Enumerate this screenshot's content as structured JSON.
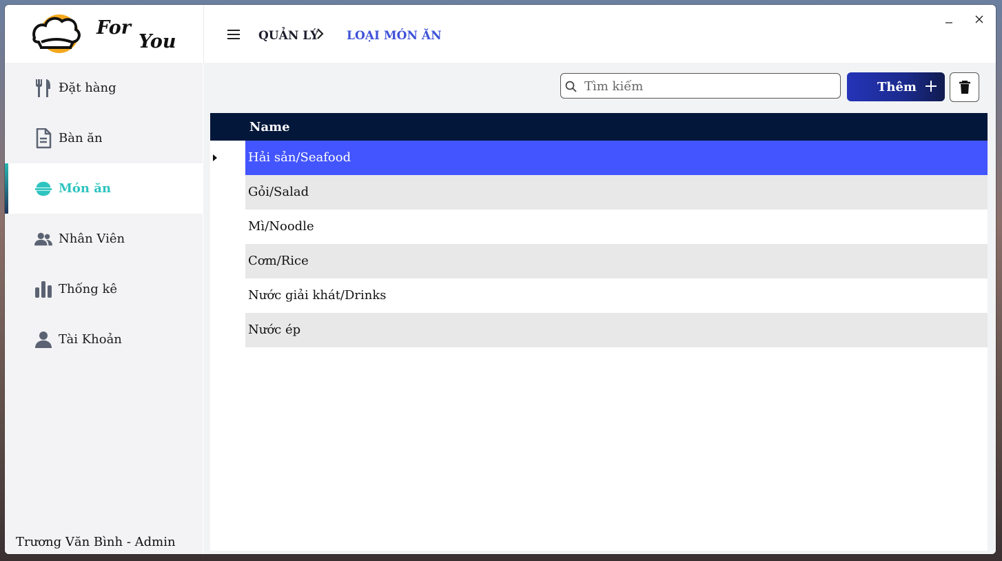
{
  "app": {
    "logo_line1": "For",
    "logo_line2": "You"
  },
  "sidebar": {
    "items": [
      {
        "label": "Đặt hàng",
        "icon": "utensils-icon"
      },
      {
        "label": "Bàn ăn",
        "icon": "document-icon"
      },
      {
        "label": "Món ăn",
        "icon": "rice-bowl-icon",
        "active": true
      },
      {
        "label": "Nhân Viên",
        "icon": "users-icon"
      },
      {
        "label": "Thống kê",
        "icon": "bar-chart-icon"
      },
      {
        "label": "Tài Khoản",
        "icon": "user-icon"
      }
    ],
    "user": "Trương Văn Bình - Admin"
  },
  "header": {
    "breadcrumb_root": "QUẢN LÝ",
    "breadcrumb_current": "LOẠI MÓN ĂN"
  },
  "toolbar": {
    "search_placeholder": "Tìm kiếm",
    "add_label": "Thêm"
  },
  "table": {
    "column": "Name",
    "rows": [
      "Hải sản/Seafood",
      "Gỏi/Salad",
      "Mì/Noodle",
      "Cơm/Rice",
      "Nước giải khát/Drinks",
      "Nước ép"
    ],
    "selected_index": 0
  },
  "colors": {
    "accent": "#4355fe",
    "active_nav": "#2ec4c0",
    "header_dark": "#02173a",
    "breadcrumb_accent": "#3f52d8"
  }
}
